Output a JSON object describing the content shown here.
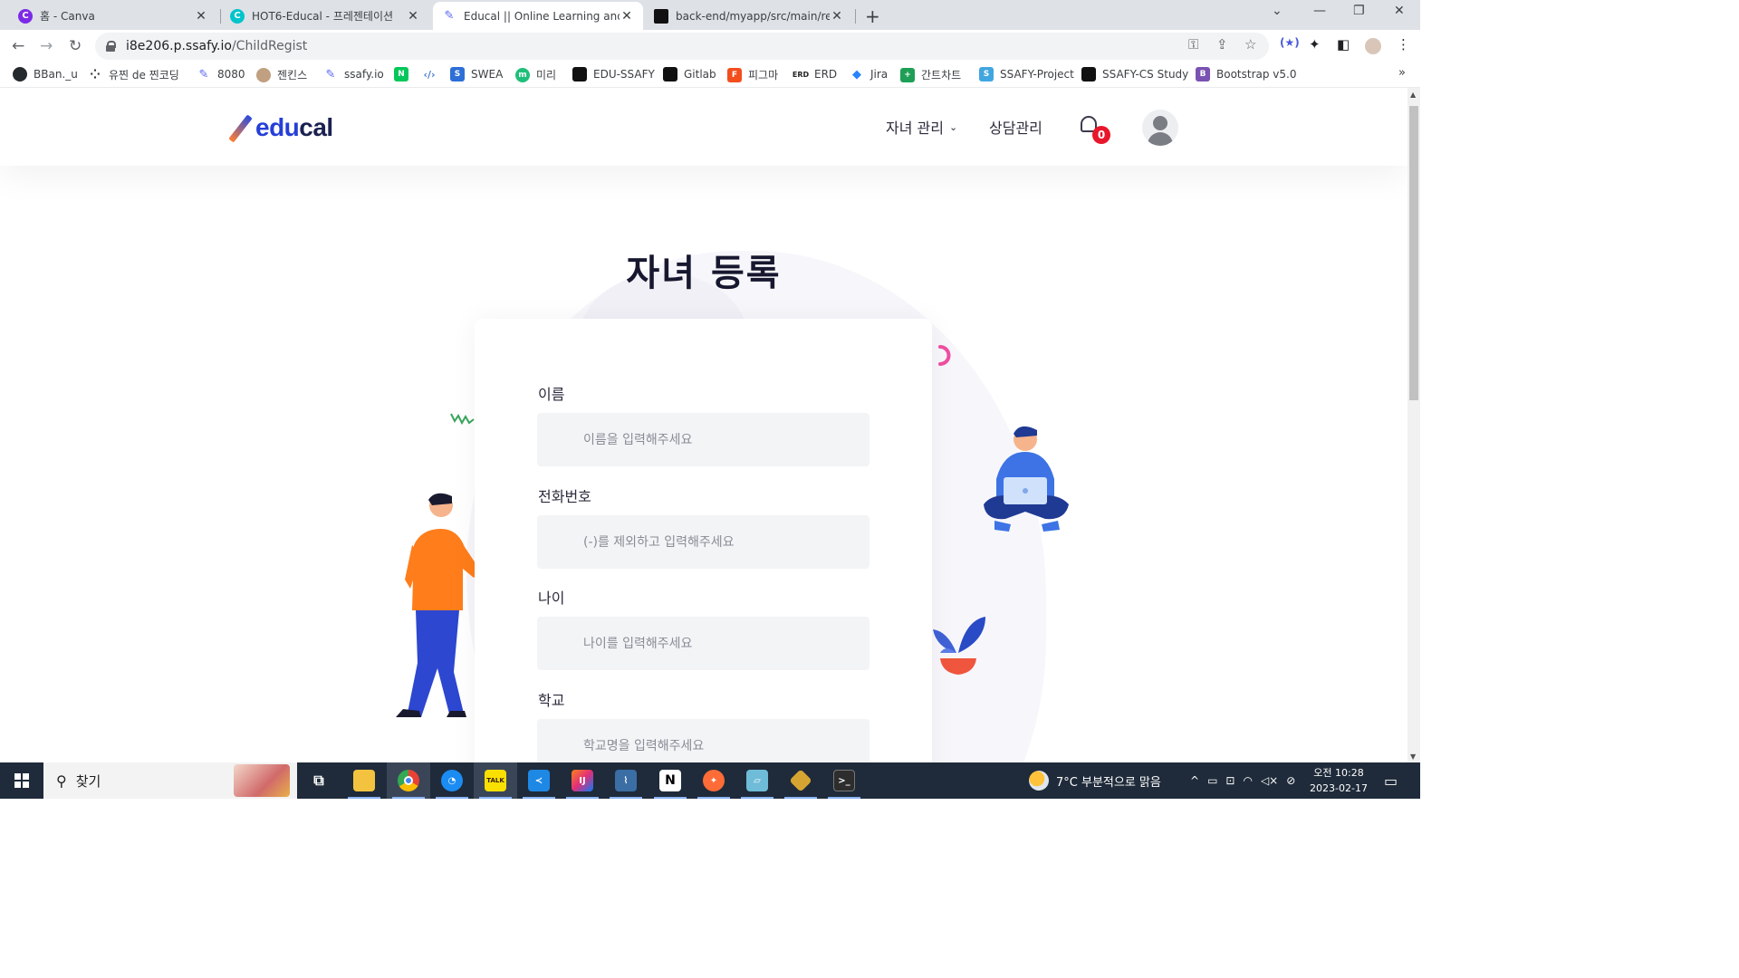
{
  "browser": {
    "tabs": [
      {
        "title": "홈 - Canva",
        "favicon": "canva-icon",
        "color": "#7d2ae8",
        "letter": "C"
      },
      {
        "title": "HOT6-Educal - 프레젠테이션",
        "favicon": "canva-icon",
        "color": "#00c4cc",
        "letter": "C"
      },
      {
        "title": "Educal || Online Learning and E",
        "favicon": "pencil-icon",
        "color": "#ffffff",
        "letter": "✎"
      },
      {
        "title": "back-end/myapp/src/main/reso",
        "favicon": "gitlab-icon",
        "color": "#111111",
        "letter": "▮"
      }
    ],
    "new_tab_symbol": "+",
    "address": {
      "domain": "i8e206.p.ssafy.io",
      "path": "/ChildRegist"
    },
    "bookmarks": [
      {
        "label": "BBan._u",
        "icon": "github-icon",
        "color": "#24292e",
        "glyph": "●"
      },
      {
        "label": "유찐 de 찐코딩",
        "icon": "dots-icon",
        "color": "#333333",
        "glyph": "⁘"
      },
      {
        "label": "8080",
        "icon": "pencil-icon",
        "color": "#5b67f1",
        "glyph": "✎"
      },
      {
        "label": "젠킨스",
        "icon": "jenkins-icon",
        "color": "#c0a080",
        "glyph": "J"
      },
      {
        "label": "ssafy.io",
        "icon": "pencil-icon",
        "color": "#5b67f1",
        "glyph": "✎"
      },
      {
        "label": "",
        "icon": "naver-icon",
        "color": "#03c75a",
        "glyph": "N"
      },
      {
        "label": "",
        "icon": "code-icon",
        "color": "#4a7bd0",
        "glyph": "<>"
      },
      {
        "label": "SWEA",
        "icon": "swea-icon",
        "color": "#2d6fd6",
        "glyph": "S"
      },
      {
        "label": "미리",
        "icon": "miri-icon",
        "color": "#1fbf7a",
        "glyph": "m"
      },
      {
        "label": "EDU-SSAFY",
        "icon": "gitlab-icon",
        "color": "#111111",
        "glyph": "▮"
      },
      {
        "label": "Gitlab",
        "icon": "gitlab-icon",
        "color": "#111111",
        "glyph": "▮"
      },
      {
        "label": "피그마",
        "icon": "figma-icon",
        "color": "#f24e1e",
        "glyph": "F"
      },
      {
        "label": "ERD",
        "icon": "erd-icon",
        "color": "#222222",
        "glyph": "ERD"
      },
      {
        "label": "Jira",
        "icon": "jira-icon",
        "color": "#2684ff",
        "glyph": "◆"
      },
      {
        "label": "간트차트",
        "icon": "sheets-icon",
        "color": "#1e9f55",
        "glyph": "+"
      },
      {
        "label": "SSAFY-Project",
        "icon": "ssafy-icon",
        "color": "#41a6e0",
        "glyph": "S"
      },
      {
        "label": "SSAFY-CS Study",
        "icon": "gitlab-icon",
        "color": "#111111",
        "glyph": "▮"
      },
      {
        "label": "Bootstrap v5.0",
        "icon": "bootstrap-icon",
        "color": "#7952b3",
        "glyph": "B"
      }
    ],
    "more_symbol": "»"
  },
  "site": {
    "logo": {
      "edu": "edu",
      "cal": "cal"
    },
    "nav": {
      "children": "자녀 관리",
      "counsel": "상담관리"
    },
    "notification_count": "0"
  },
  "form": {
    "title": "자녀 등록",
    "fields": [
      {
        "label": "이름",
        "placeholder": "이름을 입력해주세요"
      },
      {
        "label": "전화번호",
        "placeholder": "(-)를 제외하고 입력해주세요"
      },
      {
        "label": "나이",
        "placeholder": "나이를 입력해주세요"
      },
      {
        "label": "학교",
        "placeholder": "학교명을 입력해주세요"
      }
    ]
  },
  "taskbar": {
    "search_label": "찾기",
    "apps": [
      {
        "name": "task-view-icon",
        "glyph": "⧉",
        "color": "transparent"
      },
      {
        "name": "file-explorer-icon",
        "glyph": "▬",
        "color": "#f3c340"
      },
      {
        "name": "chrome-icon",
        "glyph": "◉",
        "color": "#e94235"
      },
      {
        "name": "clock-app-icon",
        "glyph": "◔",
        "color": "#1b8cf2"
      },
      {
        "name": "kakaotalk-icon",
        "glyph": "TALK",
        "color": "#f9e000"
      },
      {
        "name": "vscode-icon",
        "glyph": "≺",
        "color": "#1e88e5"
      },
      {
        "name": "intellij-icon",
        "glyph": "IJ",
        "color": "#e12e7a"
      },
      {
        "name": "mysql-workbench-icon",
        "glyph": "⌇",
        "color": "#3a6ea5"
      },
      {
        "name": "notion-icon",
        "glyph": "N",
        "color": "#ffffff"
      },
      {
        "name": "postman-icon",
        "glyph": "✦",
        "color": "#ff6c37"
      },
      {
        "name": "notes-icon",
        "glyph": "▱",
        "color": "#6fbcd8"
      },
      {
        "name": "git-icon",
        "glyph": "◆",
        "color": "#d6a531"
      },
      {
        "name": "terminal-icon",
        "glyph": ">_",
        "color": "#2d2d2d"
      }
    ],
    "weather": "7°C  부분적으로 맑음",
    "time": "오전 10:28",
    "date": "2023-02-17"
  }
}
